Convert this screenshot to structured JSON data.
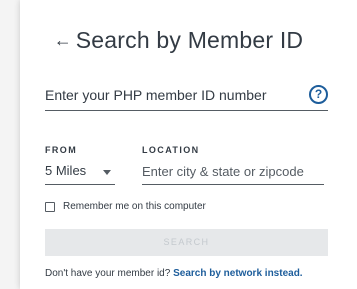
{
  "header": {
    "back_arrow_glyph": "←",
    "title": "Search by Member ID"
  },
  "member_id": {
    "placeholder": "Enter your PHP member ID number",
    "value": "",
    "help_glyph": "?"
  },
  "from": {
    "label": "FROM",
    "selected": "5 Miles"
  },
  "location": {
    "label": "LOCATION",
    "placeholder": "Enter city & state or zipcode",
    "value": ""
  },
  "remember": {
    "label": "Remember me on this computer",
    "checked": false
  },
  "search_button": {
    "label": "SEARCH",
    "enabled": false
  },
  "footer": {
    "prompt": "Don't have your member id?",
    "link": "Search by network instead."
  },
  "colors": {
    "text": "#333b44",
    "link": "#1d5d9b",
    "button_disabled_bg": "#e6e8ea",
    "button_disabled_text": "#c4c9ce"
  }
}
